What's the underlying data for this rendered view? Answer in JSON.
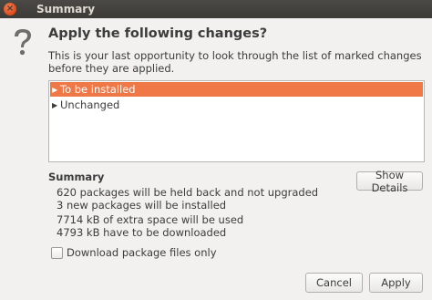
{
  "window": {
    "title": "Summary",
    "close_glyph": "×"
  },
  "dialog": {
    "heading": "Apply the following changes?",
    "intro": "This is your last opportunity to look through the list of marked changes before they are applied."
  },
  "tree": {
    "items": [
      {
        "label": "To be installed",
        "selected": true
      },
      {
        "label": "Unchanged",
        "selected": false
      }
    ]
  },
  "summary": {
    "title": "Summary",
    "lines": [
      "620 packages will be held back and not upgraded",
      "3 new packages will be installed",
      "7714 kB of extra space will be used",
      "4793 kB have to be downloaded"
    ]
  },
  "buttons": {
    "show_details": "Show Details",
    "cancel": "Cancel",
    "apply": "Apply"
  },
  "options": {
    "download_only_label": "Download package files only",
    "download_only_checked": false
  },
  "icons": {
    "close": "close-icon",
    "question": "question-icon",
    "expander": "expander-arrow-icon"
  },
  "colors": {
    "titlebar": "#3c3b37",
    "selection": "#f07746",
    "close_button": "#df4a16",
    "background": "#f2f1f0"
  }
}
